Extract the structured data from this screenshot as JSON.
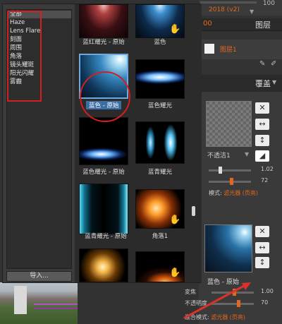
{
  "background": {
    "top_number": "100",
    "top_label": "2018 (v2)",
    "layers_hdr_num": "00",
    "layers_title": "图层",
    "layer_name": "图层1",
    "overlay_title": "覆盖",
    "thumb1_caption": "不透洁1",
    "slider1_value": "1.02",
    "slider2_value": "72",
    "blend1_label": "模式:",
    "blend1_value": "滤光器 (页亮)",
    "thumb2_caption": "蓝色 - 原始",
    "slider3_label": "変焦",
    "slider3_value": "1.00",
    "slider4_label": "不透明度",
    "slider4_value": "70",
    "blend2_label": "混合模式:",
    "blend2_value": "滤光器 (页亮)"
  },
  "categories": [
    {
      "label": "全部"
    },
    {
      "label": "Haze"
    },
    {
      "label": "Lens Flare"
    },
    {
      "label": "刻面"
    },
    {
      "label": "周围"
    },
    {
      "label": "角落"
    },
    {
      "label": "镜头耀斑"
    },
    {
      "label": "阳光闪耀"
    },
    {
      "label": "雾霾"
    }
  ],
  "import_button": "导入...",
  "tiles": [
    {
      "caption": "蓝红耀光 - 原始"
    },
    {
      "caption": "蓝色"
    },
    {
      "caption": "蓝色 - 原始"
    },
    {
      "caption": "蓝色耀光"
    },
    {
      "caption": "蓝色耀光 - 原始"
    },
    {
      "caption": "蓝青耀光"
    },
    {
      "caption": "蓝青耀光 - 原始"
    },
    {
      "caption": "角落1"
    }
  ]
}
